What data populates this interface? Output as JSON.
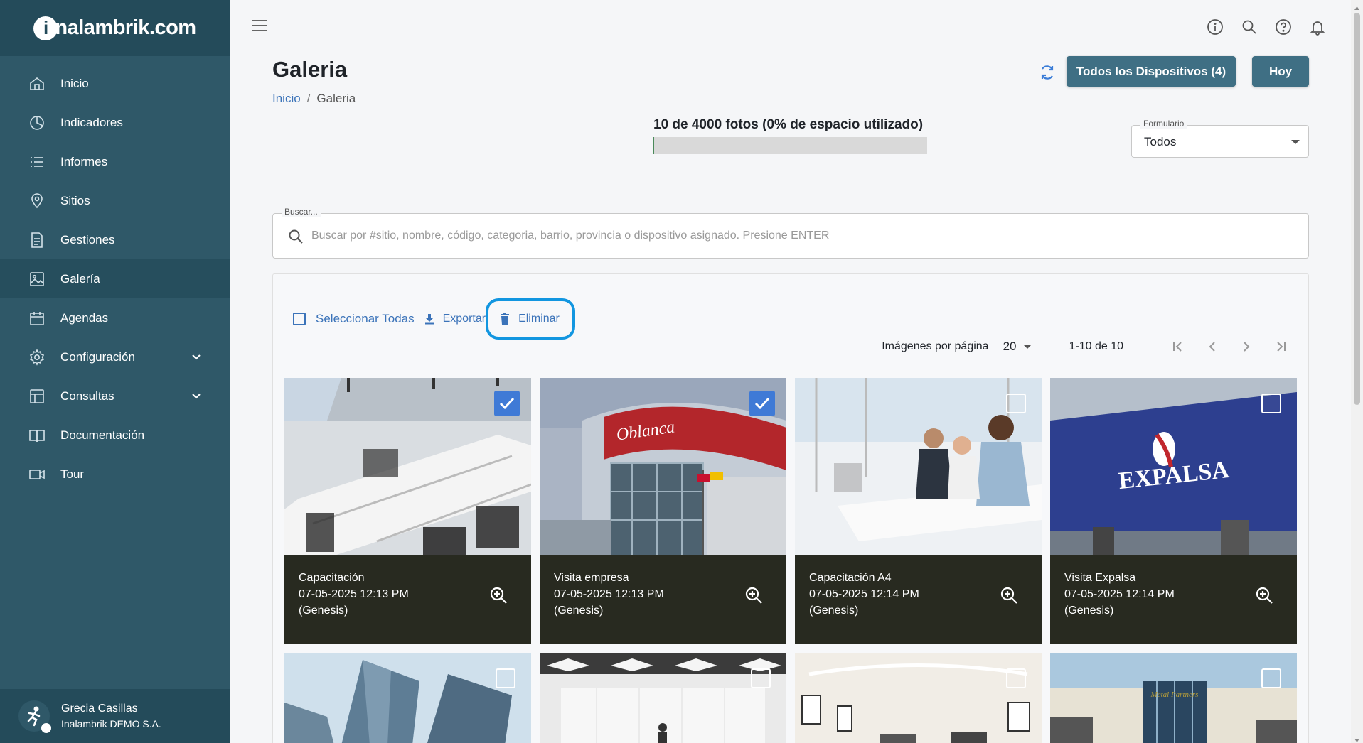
{
  "brand": {
    "logo_text": "nalambrik.com",
    "logo_letter": "i"
  },
  "sidebar": {
    "items": [
      {
        "label": "Inicio",
        "icon": "home-icon"
      },
      {
        "label": "Indicadores",
        "icon": "pie-chart-icon"
      },
      {
        "label": "Informes",
        "icon": "list-icon"
      },
      {
        "label": "Sitios",
        "icon": "location-pin-icon"
      },
      {
        "label": "Gestiones",
        "icon": "document-icon"
      },
      {
        "label": "Galería",
        "icon": "image-icon",
        "active": true
      },
      {
        "label": "Agendas",
        "icon": "calendar-icon"
      },
      {
        "label": "Configuración",
        "icon": "gear-icon",
        "expandable": true
      },
      {
        "label": "Consultas",
        "icon": "table-icon",
        "expandable": true
      },
      {
        "label": "Documentación",
        "icon": "book-icon"
      },
      {
        "label": "Tour",
        "icon": "video-camera-icon"
      }
    ]
  },
  "user": {
    "name": "Grecia Casillas",
    "org": "Inalambrik DEMO S.A."
  },
  "header": {
    "title": "Galeria",
    "breadcrumb": {
      "home": "Inicio",
      "separator": "/",
      "current": "Galeria"
    },
    "devices_button": "Todos los Dispositivos (4)",
    "today_button": "Hoy"
  },
  "storage": {
    "text": "10 de 4000 fotos (0% de espacio utilizado)",
    "used_fraction": 0.0025
  },
  "form_filter": {
    "label": "Formulario",
    "value": "Todos"
  },
  "search": {
    "label": "Buscar...",
    "placeholder": "Buscar por #sitio, nombre, código, categoria, barrio, provincia o dispositivo asignado. Presione ENTER",
    "value": ""
  },
  "toolbar": {
    "select_all": "Seleccionar Todas",
    "export": "Exportar",
    "delete": "Eliminar"
  },
  "pagination": {
    "per_page_label": "Imágenes por página",
    "per_page_value": "20",
    "range": "1-10 de 10"
  },
  "colors": {
    "sidebar": "#2f5868",
    "accent_button": "#3f6f84",
    "link": "#3b73b9",
    "caption_bg": "#282a20",
    "highlight_ring": "#1296e0"
  },
  "gallery": [
    {
      "title": "Capacitación",
      "date": "07-05-2025 12:13 PM",
      "device": "(Genesis)",
      "checked": true,
      "scene": "office"
    },
    {
      "title": "Visita empresa",
      "date": "07-05-2025 12:13 PM",
      "device": "(Genesis)",
      "checked": true,
      "scene": "building-red",
      "sign": "Oblanca"
    },
    {
      "title": "Capacitación A4",
      "date": "07-05-2025 12:14 PM",
      "device": "(Genesis)",
      "checked": false,
      "scene": "meeting"
    },
    {
      "title": "Visita Expalsa",
      "date": "07-05-2025 12:14 PM",
      "device": "(Genesis)",
      "checked": false,
      "scene": "expalsa",
      "sign": "EXPALSA"
    },
    {
      "checked": false,
      "scene": "skyscraper"
    },
    {
      "checked": false,
      "scene": "hall"
    },
    {
      "checked": false,
      "scene": "lounge"
    },
    {
      "checked": false,
      "scene": "factory",
      "sign": "Metal Partners"
    }
  ]
}
